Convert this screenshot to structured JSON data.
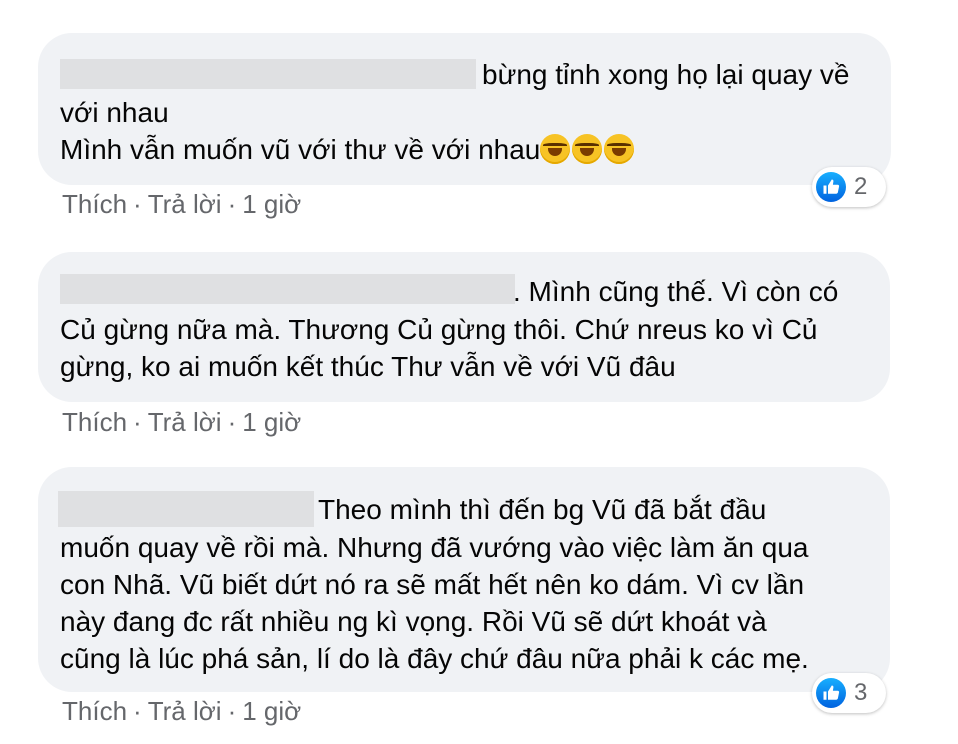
{
  "comments": [
    {
      "lines": [
        "bừng tỉnh xong họ lại quay về",
        "với nhau",
        "Mình vẫn muốn vũ với thư về với nhau"
      ],
      "emoji_icon": "laughing-tears-emoji",
      "actions": {
        "like": "Thích",
        "reply": "Trả lời",
        "time": "1 giờ",
        "separator": "·"
      },
      "reaction": {
        "icon": "like-icon",
        "count": "2"
      }
    },
    {
      "lines": [
        ". Mình cũng thế. Vì còn có",
        "Củ gừng nữa mà. Thương Củ gừng thôi. Chứ nreus ko vì Củ",
        "gừng, ko ai muốn kết thúc Thư vẫn về với Vũ đâu"
      ],
      "actions": {
        "like": "Thích",
        "reply": "Trả lời",
        "time": "1 giờ",
        "separator": "·"
      }
    },
    {
      "lines": [
        "Theo mình thì đến bg Vũ đã bắt đầu",
        "muốn quay về rồi mà. Nhưng đã vướng vào việc làm ăn qua",
        "con Nhã. Vũ biết dứt nó ra sẽ mất hết nên ko dám. Vì cv lần",
        "này đang đc rất nhiều ng kì vọng. Rồi Vũ sẽ dứt khoát và",
        "cũng là lúc phá sản, lí do là đây chứ đâu nữa phải k các mẹ."
      ],
      "actions": {
        "like": "Thích",
        "reply": "Trả lời",
        "time": "1 giờ",
        "separator": "·"
      },
      "reaction": {
        "icon": "like-icon",
        "count": "3"
      }
    }
  ],
  "colors": {
    "bubble": "#f0f2f5",
    "meta": "#65676b",
    "like_blue": "#0866ff"
  }
}
